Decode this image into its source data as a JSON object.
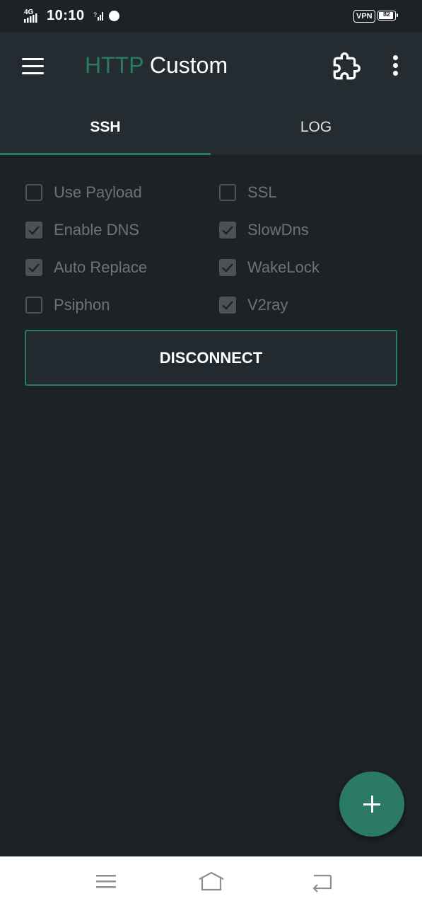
{
  "status_bar": {
    "network": "4G",
    "time": "10:10",
    "vpn": "VPN",
    "battery": "82",
    "battery_level": 0.82
  },
  "app_bar": {
    "title_part1": "HTTP",
    "title_part2": "Custom",
    "accent_color": "#2a7a65",
    "icons": [
      "menu-icon",
      "plugin-icon",
      "more-vert-icon"
    ]
  },
  "tabs": [
    {
      "label": "SSH",
      "selected": true
    },
    {
      "label": "LOG",
      "selected": false
    }
  ],
  "options": [
    {
      "label": "Use Payload",
      "checked": false
    },
    {
      "label": "SSL",
      "checked": false
    },
    {
      "label": "Enable DNS",
      "checked": true
    },
    {
      "label": "SlowDns",
      "checked": true
    },
    {
      "label": "Auto Replace",
      "checked": true
    },
    {
      "label": "WakeLock",
      "checked": true
    },
    {
      "label": "Psiphon",
      "checked": false
    },
    {
      "label": "V2ray",
      "checked": true
    }
  ],
  "disconnect_label": "DISCONNECT",
  "fab_icon": "plus-icon",
  "nav_icons": [
    "recent-apps-icon",
    "home-icon",
    "back-icon"
  ]
}
